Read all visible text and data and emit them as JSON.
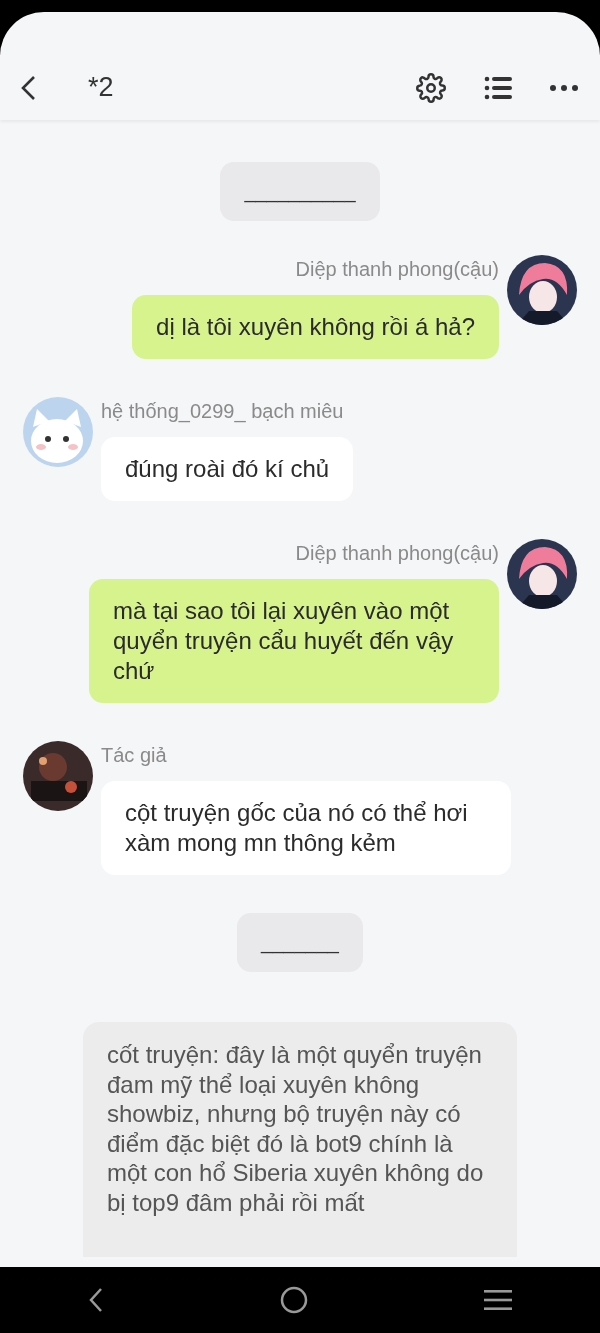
{
  "toolbar": {
    "title": "*2"
  },
  "messages": [
    {
      "kind": "divider",
      "text": "__________"
    },
    {
      "kind": "right",
      "name": "Diệp thanh phong(cậu)",
      "text": "dị là tôi xuyên không rồi á hả?"
    },
    {
      "kind": "left",
      "name": "hệ thống_0299_ bạch miêu",
      "text": "đúng roài đó kí chủ"
    },
    {
      "kind": "right",
      "name": "Diệp thanh phong(cậu)",
      "text": "mà tại sao tôi lại xuyên vào một quyển truyện cẩu huyết đến vậy chứ"
    },
    {
      "kind": "left",
      "name": "Tác giả",
      "text": "cột truyện gốc của nó có thể hơi xàm mong mn thông kẻm"
    },
    {
      "kind": "divider",
      "text": "_______"
    },
    {
      "kind": "note",
      "text": "cốt truyện: đây là một quyển truyện đam mỹ thể loại xuyên không showbiz, nhưng bộ truyện này có điểm đặc biệt đó là bot9 chính là một con hổ Siberia xuyên không do bị top9 đâm phải rồi mất"
    }
  ]
}
